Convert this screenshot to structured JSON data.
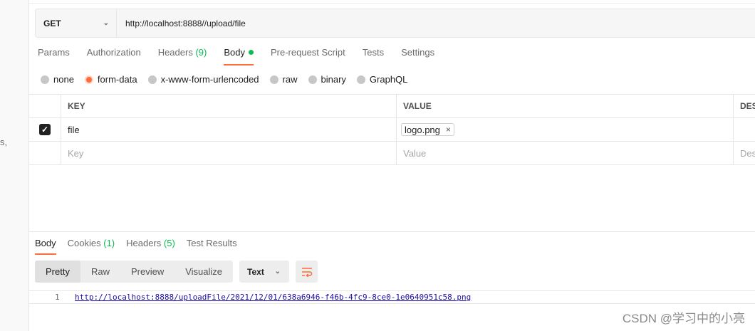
{
  "left_fragment": "s,",
  "request": {
    "method": "GET",
    "url": "http://localhost:8888//upload/file"
  },
  "request_tabs": [
    {
      "label": "Params"
    },
    {
      "label": "Authorization"
    },
    {
      "label": "Headers",
      "count": "(9)"
    },
    {
      "label": "Body"
    },
    {
      "label": "Pre-request Script"
    },
    {
      "label": "Tests"
    },
    {
      "label": "Settings"
    }
  ],
  "body_types": [
    "none",
    "form-data",
    "x-www-form-urlencoded",
    "raw",
    "binary",
    "GraphQL"
  ],
  "table": {
    "headers": {
      "key": "KEY",
      "value": "VALUE",
      "description": "DES"
    },
    "row": {
      "key": "file",
      "value_file": "logo.png",
      "remove_glyph": "×"
    },
    "placeholders": {
      "key": "Key",
      "value": "Value",
      "description": "Des"
    }
  },
  "response_tabs": [
    {
      "label": "Body"
    },
    {
      "label": "Cookies",
      "count": "(1)"
    },
    {
      "label": "Headers",
      "count": "(5)"
    },
    {
      "label": "Test Results"
    }
  ],
  "view_modes": [
    "Pretty",
    "Raw",
    "Preview",
    "Visualize"
  ],
  "format": "Text",
  "response_body": {
    "line_number": "1",
    "text": "http://localhost:8888/uploadFile/2021/12/01/638a6946-f46b-4fc9-8ce0-1e0640951c58.png"
  },
  "watermark": "CSDN @学习中的小亮",
  "icons": {
    "method_dropdown": "chevron-down-icon",
    "format_dropdown": "chevron-down-icon",
    "wrap": "wrap-lines-icon",
    "checkbox": "check-icon"
  },
  "colors": {
    "accent": "#ff6c37",
    "status_green": "#0cbb52",
    "link": "#1a0dab"
  }
}
